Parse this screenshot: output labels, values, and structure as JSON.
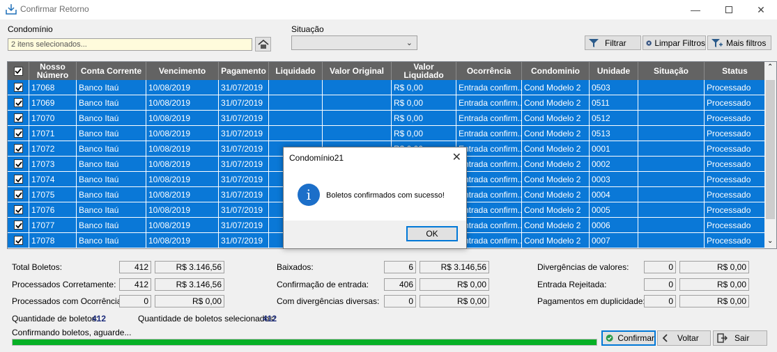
{
  "window": {
    "title": "Confirmar Retorno",
    "controls": [
      "minimize-icon",
      "maximize-icon",
      "close-icon"
    ]
  },
  "filters": {
    "condominio_label": "Condomínio",
    "condominio_value": "2 itens selecionados...",
    "situacao_label": "Situação",
    "situacao_value": "",
    "filtrar": "Filtrar",
    "limpar": "Limpar Filtros",
    "mais": "Mais filtros"
  },
  "grid": {
    "columns": [
      "Nosso Número",
      "Conta Corrente",
      "Vencimento",
      "Pagamento",
      "Liquidado",
      "Valor Original",
      "Valor Liquidado",
      "Ocorrência",
      "Condominio",
      "Unidade",
      "Situação",
      "Status"
    ],
    "rows": [
      [
        "17068",
        "Banco Itaú",
        "10/08/2019",
        "31/07/2019",
        "",
        "",
        "R$ 0,00",
        "Entrada confirm...",
        "Cond Modelo 2",
        "0503",
        "",
        "Processado"
      ],
      [
        "17069",
        "Banco Itaú",
        "10/08/2019",
        "31/07/2019",
        "",
        "",
        "R$ 0,00",
        "Entrada confirm...",
        "Cond Modelo 2",
        "0511",
        "",
        "Processado"
      ],
      [
        "17070",
        "Banco Itaú",
        "10/08/2019",
        "31/07/2019",
        "",
        "",
        "R$ 0,00",
        "Entrada confirm...",
        "Cond Modelo 2",
        "0512",
        "",
        "Processado"
      ],
      [
        "17071",
        "Banco Itaú",
        "10/08/2019",
        "31/07/2019",
        "",
        "",
        "R$ 0,00",
        "Entrada confirm...",
        "Cond Modelo 2",
        "0513",
        "",
        "Processado"
      ],
      [
        "17072",
        "Banco Itaú",
        "10/08/2019",
        "31/07/2019",
        "",
        "",
        "R$ 0,00",
        "Entrada confirm...",
        "Cond Modelo 2",
        "0001",
        "",
        "Processado"
      ],
      [
        "17073",
        "Banco Itaú",
        "10/08/2019",
        "31/07/2019",
        "",
        "",
        "",
        "Entrada confirm...",
        "Cond Modelo 2",
        "0002",
        "",
        "Processado"
      ],
      [
        "17074",
        "Banco Itaú",
        "10/08/2019",
        "31/07/2019",
        "",
        "",
        "",
        "Entrada confirm...",
        "Cond Modelo 2",
        "0003",
        "",
        "Processado"
      ],
      [
        "17075",
        "Banco Itaú",
        "10/08/2019",
        "31/07/2019",
        "",
        "",
        "",
        "Entrada confirm...",
        "Cond Modelo 2",
        "0004",
        "",
        "Processado"
      ],
      [
        "17076",
        "Banco Itaú",
        "10/08/2019",
        "31/07/2019",
        "",
        "",
        "",
        "Entrada confirm...",
        "Cond Modelo 2",
        "0005",
        "",
        "Processado"
      ],
      [
        "17077",
        "Banco Itaú",
        "10/08/2019",
        "31/07/2019",
        "",
        "",
        "",
        "Entrada confirm...",
        "Cond Modelo 2",
        "0006",
        "",
        "Processado"
      ],
      [
        "17078",
        "Banco Itaú",
        "10/08/2019",
        "31/07/2019",
        "",
        "",
        "",
        "Entrada confirm...",
        "Cond Modelo 2",
        "0007",
        "",
        "Processado"
      ]
    ],
    "row_color": "#0a78d7",
    "header_color": "#636363"
  },
  "dialog": {
    "title": "Condomínio21",
    "message": "Boletos confirmados com sucesso!",
    "ok": "OK",
    "icon": "info-icon"
  },
  "summary": {
    "total_label": "Total Boletos:",
    "total_qty": "412",
    "total_val": "R$ 3.146,56",
    "proc_label": "Processados Corretamente:",
    "proc_qty": "412",
    "proc_val": "R$ 3.146,56",
    "oco_label": "Processados com Ocorrências:",
    "oco_qty": "0",
    "oco_val": "R$ 0,00",
    "baix_label": "Baixados:",
    "baix_qty": "6",
    "baix_val": "R$ 3.146,56",
    "conf_label": "Confirmação de entrada:",
    "conf_qty": "406",
    "conf_val": "R$ 0,00",
    "div_label": "Com divergências diversas:",
    "div_qty": "0",
    "div_val": "R$ 0,00",
    "dval_label": "Divergências de valores:",
    "dval_qty": "0",
    "dval_val": "R$ 0,00",
    "rej_label": "Entrada Rejeitada:",
    "rej_qty": "0",
    "rej_val": "R$ 0,00",
    "dup_label": "Pagamentos em duplicidade:",
    "dup_qty": "0",
    "dup_val": "R$ 0,00",
    "qtd_label": "Quantidade de boletos:",
    "qtd_value": "412",
    "qtd_sel_label": "Quantidade de boletos selecionados:",
    "qtd_sel_value": "412",
    "status_text": "Confirmando boletos, aguarde...",
    "progress": 1.0
  },
  "buttons": {
    "confirmar": "Confirmar",
    "voltar": "Voltar",
    "sair": "Sair"
  }
}
